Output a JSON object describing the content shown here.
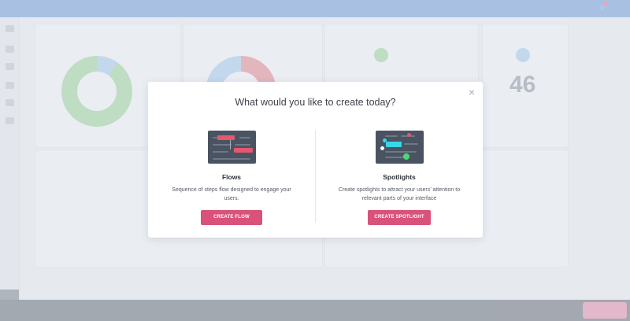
{
  "modal": {
    "title": "What would you like to create today?",
    "close_glyph": "×"
  },
  "options": [
    {
      "title": "Flows",
      "description": "Sequence of steps flow designed to engage your users.",
      "button": "CREATE FLOW",
      "illustration": "flows-illustration"
    },
    {
      "title": "Spotlights",
      "description": "Create spotlights to attract your users’ attention to relevant parts of your interface",
      "button": "CREATE SPOTLIGHT",
      "illustration": "spotlights-illustration"
    }
  ],
  "background": {
    "numbers": [
      "46"
    ]
  },
  "colors": {
    "accent": "#d9527a",
    "topbar": "#5b8fd6",
    "illustration_bg": "#4a5361",
    "flow_block": "#e5566f",
    "spotlight_cyan": "#37d6ea",
    "spotlight_green": "#4fd67a"
  }
}
